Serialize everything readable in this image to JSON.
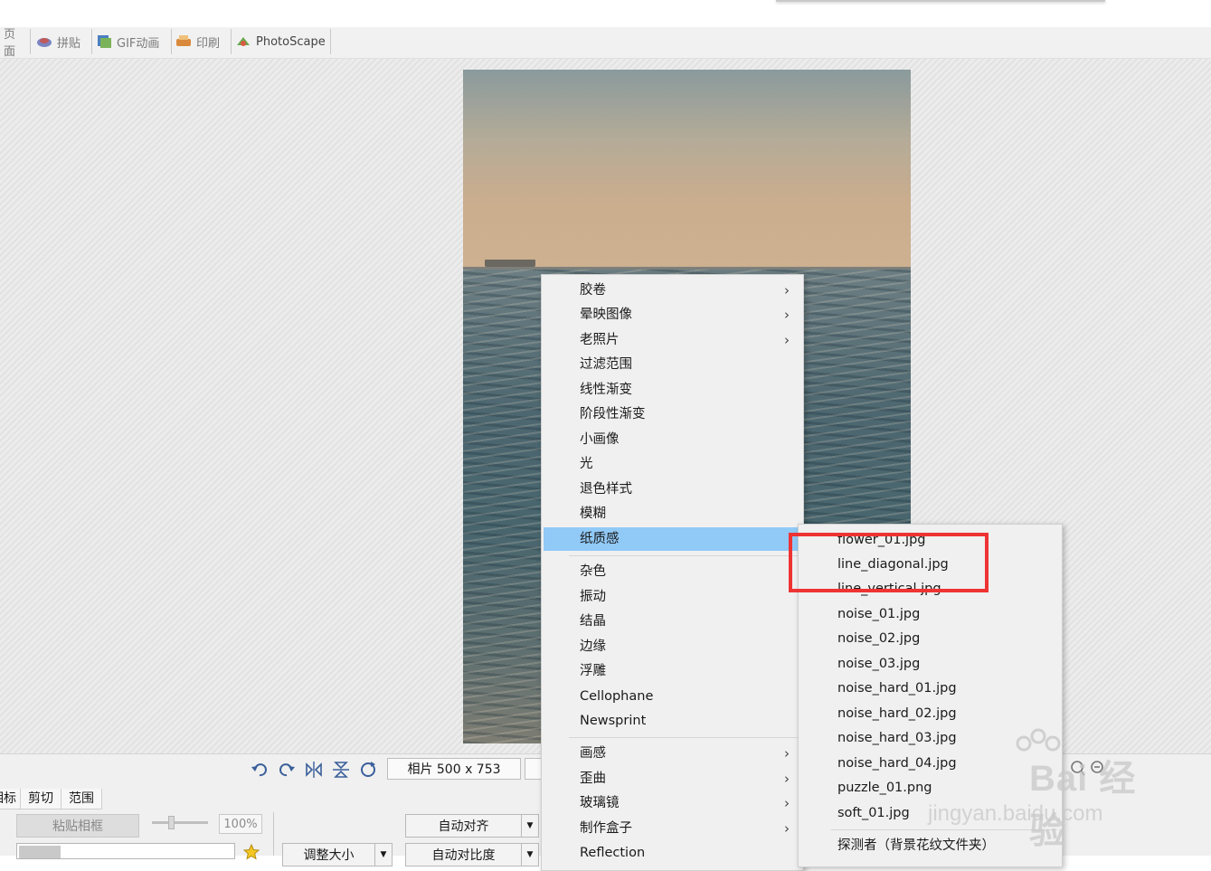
{
  "tabs": [
    {
      "label": "页面",
      "icon": "page-icon"
    },
    {
      "label": "拼贴",
      "icon": "combine-icon"
    },
    {
      "label": "GIF动画",
      "icon": "gif-icon"
    },
    {
      "label": "印刷",
      "icon": "print-icon"
    },
    {
      "label": "PhotoScape",
      "icon": "photoscape-icon"
    }
  ],
  "status": {
    "photo_size": "相片 500 x 753"
  },
  "bottom_tabs": [
    "相标",
    "剪切",
    "范围"
  ],
  "controls": {
    "paste_frame": "粘贴相框",
    "zoom": "100%",
    "auto_align": "自动对齐",
    "resize": "调整大小",
    "auto_contrast": "自动对比度"
  },
  "menu": {
    "items": [
      {
        "label": "胶卷",
        "submenu": true
      },
      {
        "label": "晕映图像",
        "submenu": true
      },
      {
        "label": "老照片",
        "submenu": true
      },
      {
        "label": "过滤范围",
        "submenu": false
      },
      {
        "label": "线性渐变",
        "submenu": false
      },
      {
        "label": "阶段性渐变",
        "submenu": false
      },
      {
        "label": "小画像",
        "submenu": false
      },
      {
        "label": "光",
        "submenu": false
      },
      {
        "label": "退色样式",
        "submenu": false
      },
      {
        "label": "模糊",
        "submenu": false
      },
      {
        "label": "纸质感",
        "submenu": false,
        "highlighted": true
      },
      {
        "label": "杂色",
        "submenu": false
      },
      {
        "label": "振动",
        "submenu": false
      },
      {
        "label": "结晶",
        "submenu": false
      },
      {
        "label": "边缘",
        "submenu": false
      },
      {
        "label": "浮雕",
        "submenu": false
      },
      {
        "label": "Cellophane",
        "submenu": false
      },
      {
        "label": "Newsprint",
        "submenu": false
      },
      {
        "label": "画感",
        "submenu": true
      },
      {
        "label": "歪曲",
        "submenu": true
      },
      {
        "label": "玻璃镜",
        "submenu": true
      },
      {
        "label": "制作盒子",
        "submenu": true
      },
      {
        "label": "Reflection",
        "submenu": false
      }
    ]
  },
  "submenu": {
    "items": [
      "flower_01.jpg",
      "line_diagonal.jpg",
      "line_vertical.jpg",
      "noise_01.jpg",
      "noise_02.jpg",
      "noise_03.jpg",
      "noise_hard_01.jpg",
      "noise_hard_02.jpg",
      "noise_hard_03.jpg",
      "noise_hard_04.jpg",
      "puzzle_01.png",
      "soft_01.jpg"
    ],
    "footer": "探测者（背景花纹文件夹）"
  },
  "watermark": {
    "brand": "Bai 经验",
    "url": "jingyan.baidu.com"
  },
  "colors": {
    "highlight": "#91c9f7",
    "annotation_box": "#ee3333"
  }
}
